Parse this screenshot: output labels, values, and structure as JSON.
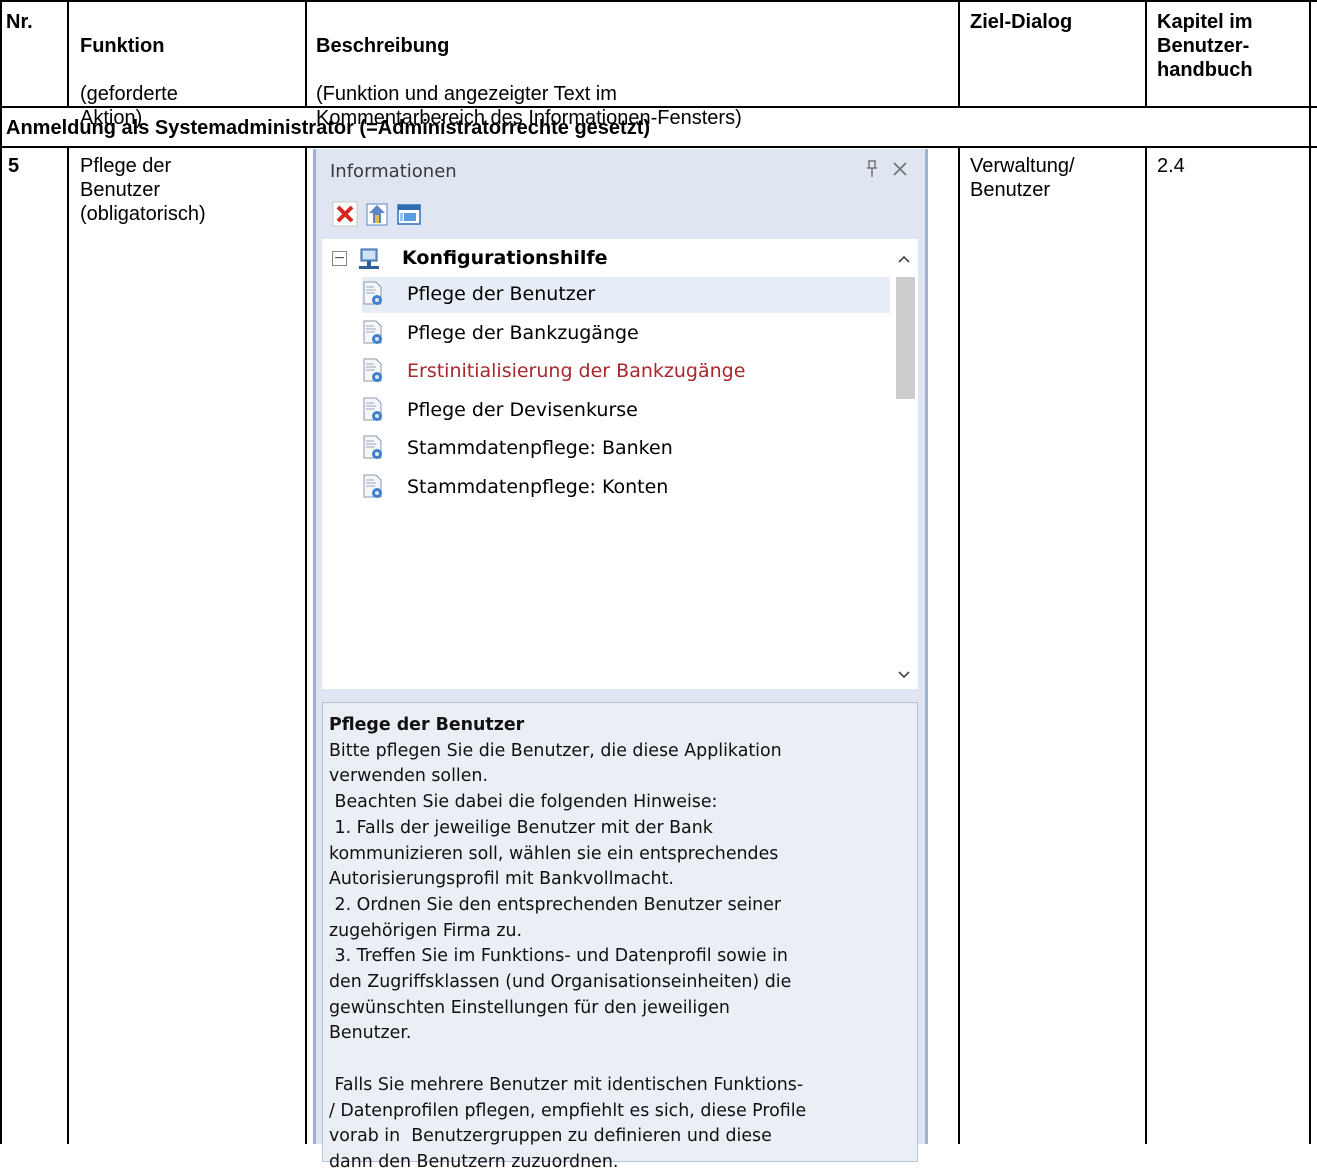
{
  "table": {
    "headers": {
      "nr": "Nr.",
      "funktion_title": "Funktion",
      "funktion_sub": "(geforderte\nAktion)",
      "beschreibung_title": "Beschreibung",
      "beschreibung_sub": "(Funktion und angezeigter Text im\nKommentarbereich des Informationen-Fensters)",
      "ziel": "Ziel-Dialog",
      "kapitel": "Kapitel im\nBenutzer-\nhandbuch"
    },
    "section_title": "Anmeldung als Systemadministrator (=Administratorrechte gesetzt)",
    "row": {
      "nr": "5",
      "funktion": "Pflege der\nBenutzer\n(obligatorisch)",
      "ziel": "Verwaltung/\nBenutzer",
      "kapitel": "2.4"
    }
  },
  "panel": {
    "title": "Informationen",
    "pin_icon": "pin-icon",
    "close_icon": "close-icon",
    "toolbar": [
      "delete-icon",
      "home-icon",
      "window-icon"
    ],
    "tree": {
      "expander": "⊟",
      "root_label": "Konfigurationshilfe",
      "items": [
        {
          "label": "Pflege der Benutzer",
          "selected": true,
          "color": "#000000"
        },
        {
          "label": "Pflege der Bankzugänge",
          "selected": false,
          "color": "#000000"
        },
        {
          "label": "Erstinitialisierung der Bankzugänge",
          "selected": false,
          "color": "#a8272b"
        },
        {
          "label": "Pflege der Devisenkurse",
          "selected": false,
          "color": "#000000"
        },
        {
          "label": "Stammdatenpflege: Banken",
          "selected": false,
          "color": "#000000"
        },
        {
          "label": "Stammdatenpflege: Konten",
          "selected": false,
          "color": "#000000"
        }
      ]
    },
    "description": {
      "title": "Pflege der Benutzer",
      "body": "Bitte pflegen Sie die Benutzer, die diese Applikation\nverwenden sollen.\n Beachten Sie dabei die folgenden Hinweise:\n 1. Falls der jeweilige Benutzer mit der Bank\nkommunizieren soll, wählen sie ein entsprechendes\nAutorisierungsprofil mit Bankvollmacht.\n 2. Ordnen Sie den entsprechenden Benutzer seiner\nzugehörigen Firma zu.\n 3. Treffen Sie im Funktions- und Datenprofil sowie in\nden Zugriffsklassen (und Organisationseinheiten) die\ngewünschten Einstellungen für den jeweiligen\nBenutzer.\n\n Falls Sie mehrere Benutzer mit identischen Funktions-\n/ Datenprofilen pflegen, empfiehlt es sich, diese Profile\nvorab in  Benutzergruppen zu definieren und diese\ndann den Benutzern zuzuordnen."
    }
  }
}
